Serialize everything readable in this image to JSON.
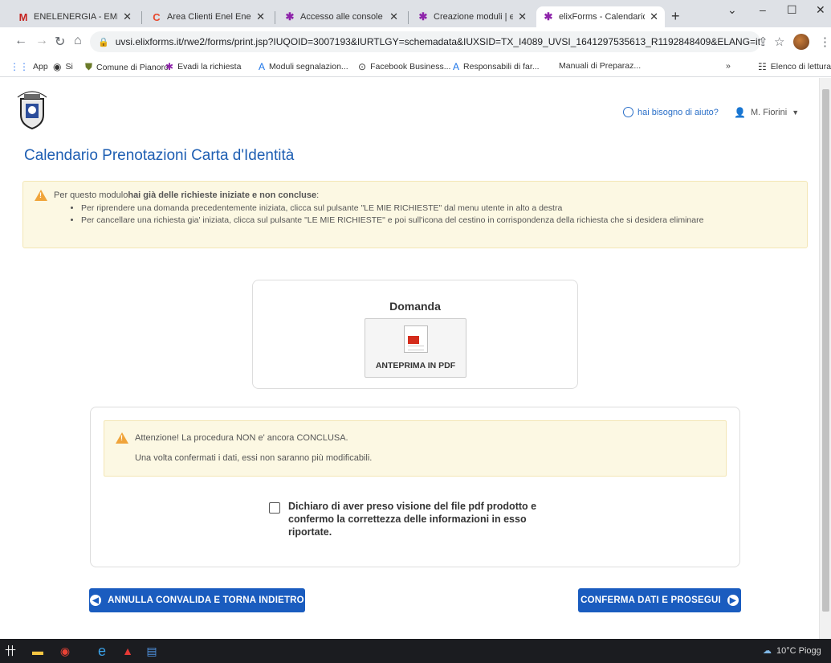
{
  "browser": {
    "tabs": [
      {
        "title": "ENELENERGIA - EMISSION",
        "icon": "gmail-icon",
        "color": "#c5221f"
      },
      {
        "title": "Area Clienti Enel Energia",
        "icon": "enel-icon",
        "color": "#e8482d"
      },
      {
        "title": "Accesso alle console | elixF",
        "icon": "elixforms-icon",
        "color": "#8e24aa"
      },
      {
        "title": "Creazione moduli | elixFor",
        "icon": "elixforms-icon",
        "color": "#8e24aa"
      },
      {
        "title": "elixForms - Calendario Pre",
        "icon": "elixforms-icon",
        "color": "#8e24aa",
        "active": true
      }
    ],
    "url": "uvsi.elixforms.it/rwe2/forms/print.jsp?IUQOID=3007193&IURTLGY=schemadata&IUXSID=TX_I4089_UVSI_1641297535613_R1192848409&ELANG=it",
    "bookmarks": [
      {
        "label": "App",
        "icon": "apps-icon"
      },
      {
        "label": "Si",
        "icon": "globe-icon"
      },
      {
        "label": "Comune di Pianoro",
        "icon": "crest-icon"
      },
      {
        "label": "Evadi la richiesta",
        "icon": "elixforms-icon"
      },
      {
        "label": "Moduli segnalazion...",
        "icon": "forms-icon"
      },
      {
        "label": "Facebook Business...",
        "icon": "facebook-business-icon"
      },
      {
        "label": "Responsabili di far...",
        "icon": "forms-icon"
      },
      {
        "label": "Manuali di Preparaz...",
        "icon": ""
      }
    ],
    "reading_list": "Elenco di lettura"
  },
  "header": {
    "help": "hai bisogno di aiuto?",
    "user": "M. Fiorini"
  },
  "page": {
    "title": "Calendario Prenotazioni Carta d'Identità",
    "notice": {
      "prefix": "Per questo modulo ",
      "bold": "hai già delle richieste iniziate e non concluse",
      "suffix": ":",
      "items": [
        "Per riprendere una domanda precedentemente iniziata, clicca sul pulsante \"LE MIE RICHIESTE\" dal menu utente in alto a destra",
        "Per cancellare una richiesta gia' iniziata, clicca sul pulsante \"LE MIE RICHIESTE\" e poi sull'icona del cestino in corrispondenza della richiesta che si desidera eliminare"
      ]
    },
    "pdf": {
      "title": "Domanda",
      "button": "ANTEPRIMA IN PDF"
    },
    "warning": {
      "line1": "Attenzione! La procedura NON e' ancora CONCLUSA.",
      "line2": "Una volta confermati i dati, essi non saranno più modificabili."
    },
    "checkbox_label": "Dichiaro di aver preso visione del file pdf prodotto e confermo la correttezza delle informazioni in esso riportate.",
    "checkbox_checked": false,
    "btn_back": "ANNULLA CONVALIDA E TORNA INDIETRO",
    "btn_next": "CONFERMA DATI E PROSEGUI"
  },
  "taskbar": {
    "weather": "10°C Piogg"
  }
}
